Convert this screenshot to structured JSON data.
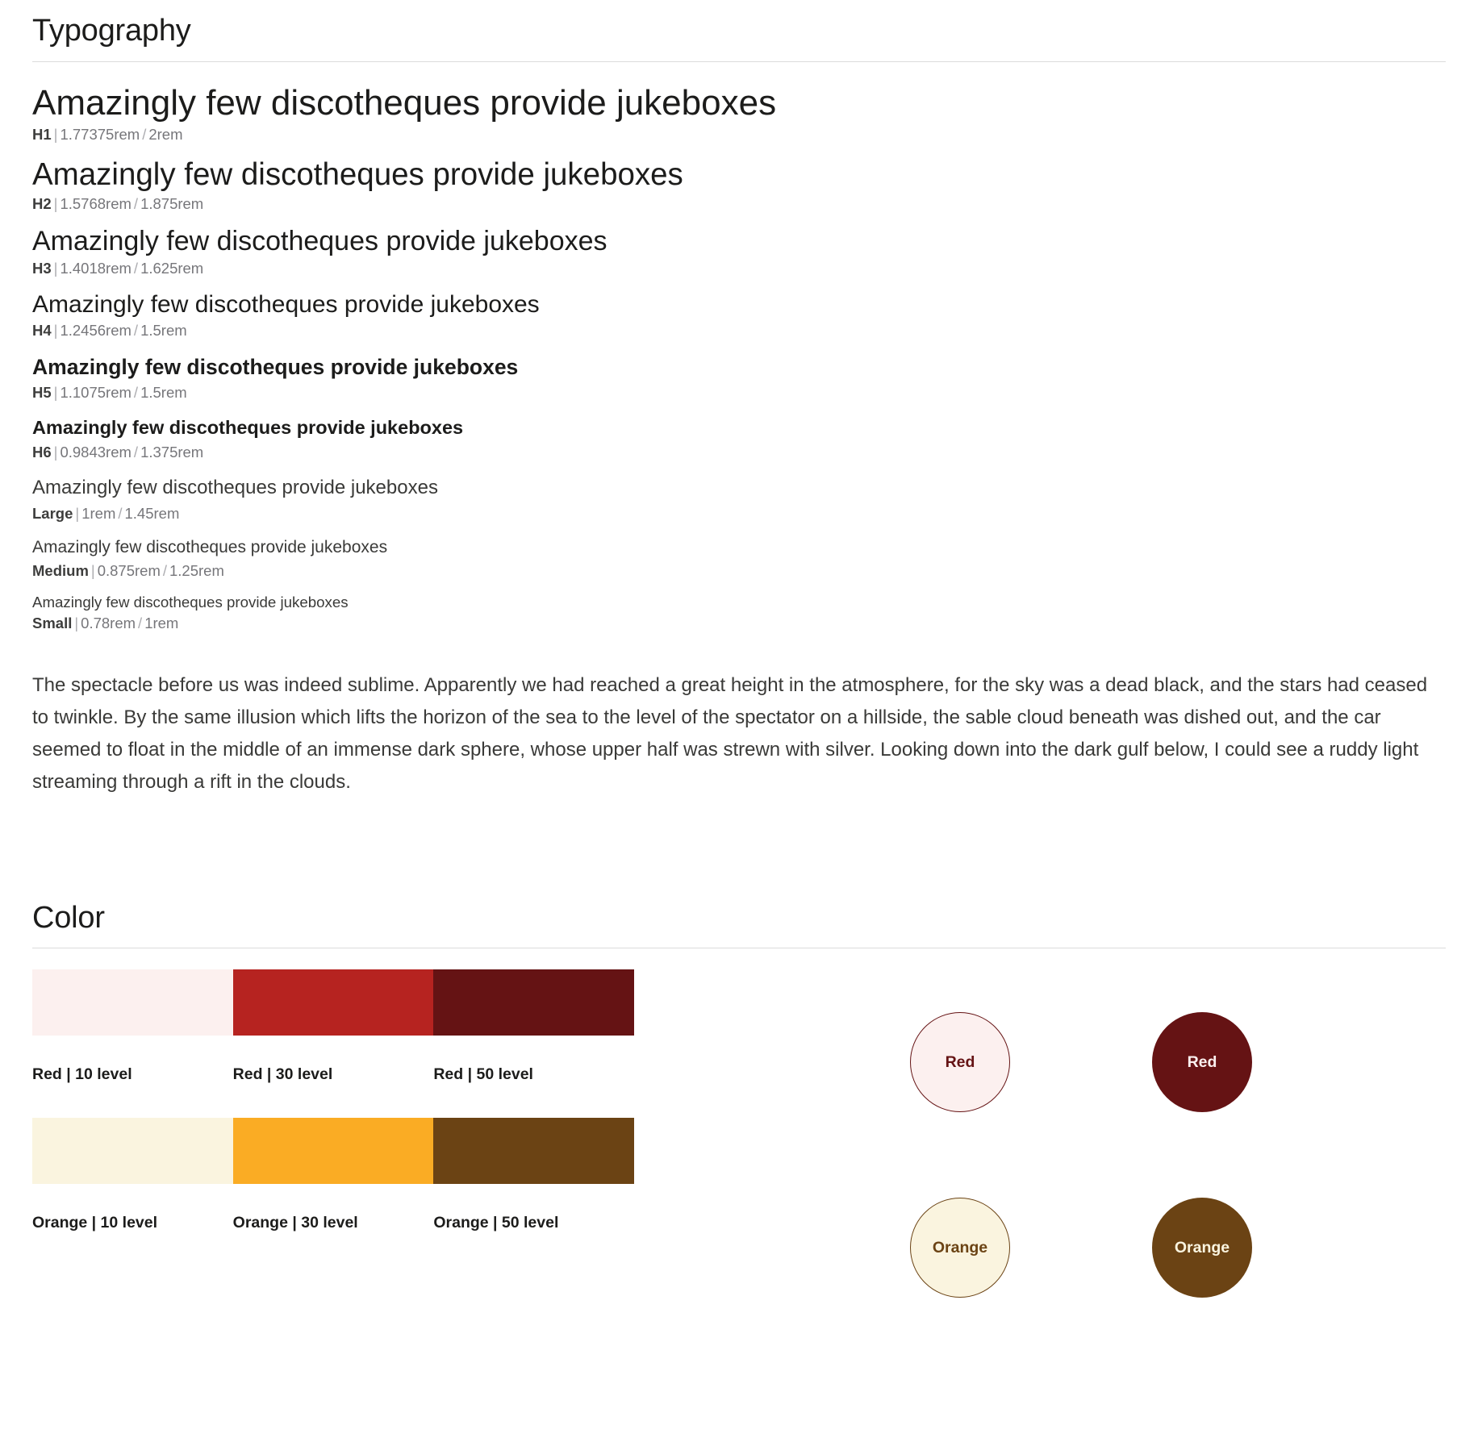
{
  "typography": {
    "section_title": "Typography",
    "specimen_text": "Amazingly few discotheques provide jukeboxes",
    "rows": [
      {
        "name": "H1",
        "size": "1.77375rem",
        "line_height": "2rem",
        "separator": "|",
        "slash": "/"
      },
      {
        "name": "H2",
        "size": "1.5768rem",
        "line_height": "1.875rem",
        "separator": "|",
        "slash": "/"
      },
      {
        "name": "H3",
        "size": "1.4018rem",
        "line_height": "1.625rem",
        "separator": "|",
        "slash": "/"
      },
      {
        "name": "H4",
        "size": "1.2456rem",
        "line_height": "1.5rem",
        "separator": "|",
        "slash": "/"
      },
      {
        "name": "H5",
        "size": "1.1075rem",
        "line_height": "1.5rem",
        "separator": "|",
        "slash": "/"
      },
      {
        "name": "H6",
        "size": "0.9843rem",
        "line_height": "1.375rem",
        "separator": "|",
        "slash": "/"
      },
      {
        "name": "Large",
        "size": "1rem",
        "line_height": "1.45rem",
        "separator": "|",
        "slash": "/"
      },
      {
        "name": "Medium",
        "size": "0.875rem",
        "line_height": "1.25rem",
        "separator": "|",
        "slash": "/"
      },
      {
        "name": "Small",
        "size": "0.78rem",
        "line_height": "1rem",
        "separator": "|",
        "slash": "/"
      }
    ],
    "body_copy": "The spectacle before us was indeed sublime. Apparently we had reached a great height in the atmosphere, for the sky was a dead black, and the stars had ceased to twinkle. By the same illusion which lifts the horizon of the sea to the level of the spectator on a hillside, the sable cloud beneath was dished out, and the car seemed to float in the middle of an immense dark sphere, whose upper half was strewn with silver. Looking down into the dark gulf below, I could see a ruddy light streaming through a rift in the clouds."
  },
  "color": {
    "section_title": "Color",
    "ramps": [
      {
        "family": "Red",
        "swatches": [
          {
            "label": "Red | 10 level",
            "hex": "#FCF0EF"
          },
          {
            "label": "Red | 30 level",
            "hex": "#B62320"
          },
          {
            "label": "Red | 50 level",
            "hex": "#651314"
          }
        ]
      },
      {
        "family": "Orange",
        "swatches": [
          {
            "label": "Orange | 10 level",
            "hex": "#FAF4DF"
          },
          {
            "label": "Orange | 30 level",
            "hex": "#FAAC24"
          },
          {
            "label": "Orange | 50 level",
            "hex": "#6B4314"
          }
        ]
      }
    ],
    "circles": [
      [
        {
          "label": "Red",
          "bg": "#FCF0EF",
          "fg": "#651314",
          "border": "#651314"
        },
        {
          "label": "Red",
          "bg": "#651314",
          "fg": "#FCF0EF",
          "border": "#651314"
        }
      ],
      [
        {
          "label": "Orange",
          "bg": "#FAF4DF",
          "fg": "#6B4314",
          "border": "#6B4314"
        },
        {
          "label": "Orange",
          "bg": "#6B4314",
          "fg": "#FAF4DF",
          "border": "#6B4314"
        }
      ]
    ]
  }
}
